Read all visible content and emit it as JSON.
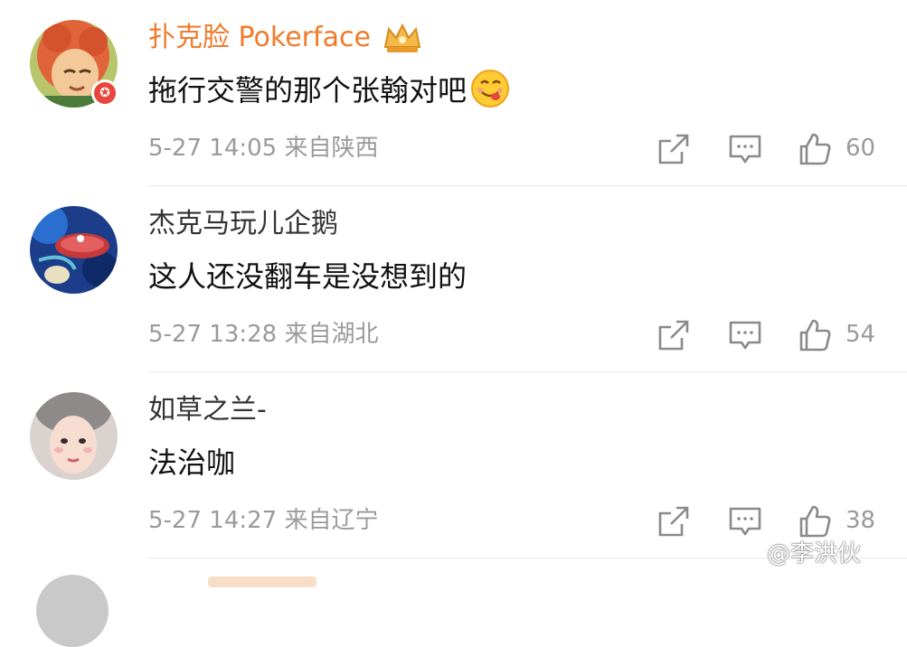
{
  "comments": [
    {
      "username": "扑克脸 Pokerface",
      "username_color": "#f07b2a",
      "text": "拖行交警的那个张翰对吧",
      "emoji": "yum-face-emoji",
      "has_crown_badge": true,
      "has_verified_badge": true,
      "meta": "5-27 14:05 来自陕西",
      "likes": "60"
    },
    {
      "username": "杰克马玩儿企鹅",
      "username_color": "#333333",
      "text": "这人还没翻车是没想到的",
      "meta": "5-27 13:28 来自湖北",
      "likes": "54"
    },
    {
      "username": "如草之兰-",
      "username_color": "#333333",
      "text": "法治咖",
      "meta": "5-27 14:27 来自辽宁",
      "likes": "38"
    }
  ],
  "icons": {
    "share": "share-icon",
    "comment": "comment-icon",
    "like": "thumbs-up-icon"
  },
  "watermark": "@李洪伙"
}
